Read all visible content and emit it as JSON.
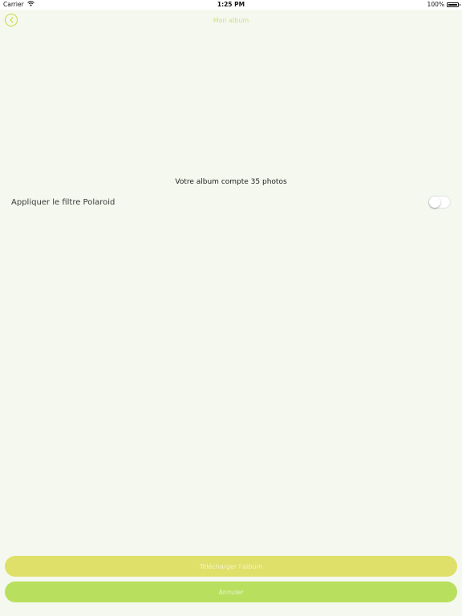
{
  "status_bar": {
    "carrier": "Carrier",
    "time": "1:25 PM",
    "battery": "100%",
    "battery_level": 100
  },
  "nav": {
    "title": "Mon album",
    "back_icon": "chevron-left-icon"
  },
  "content": {
    "album_count": "Votre album compte 35 photos",
    "filter_label": "Appliquer le filtre Polaroid",
    "filter_enabled": false
  },
  "buttons": {
    "download": "Télécharger l'album",
    "cancel": "Annuler"
  },
  "colors": {
    "background": "#f5f8ee",
    "accent": "#c8d93a",
    "download_button": "#dfe06a",
    "cancel_button": "#b8df5e"
  }
}
